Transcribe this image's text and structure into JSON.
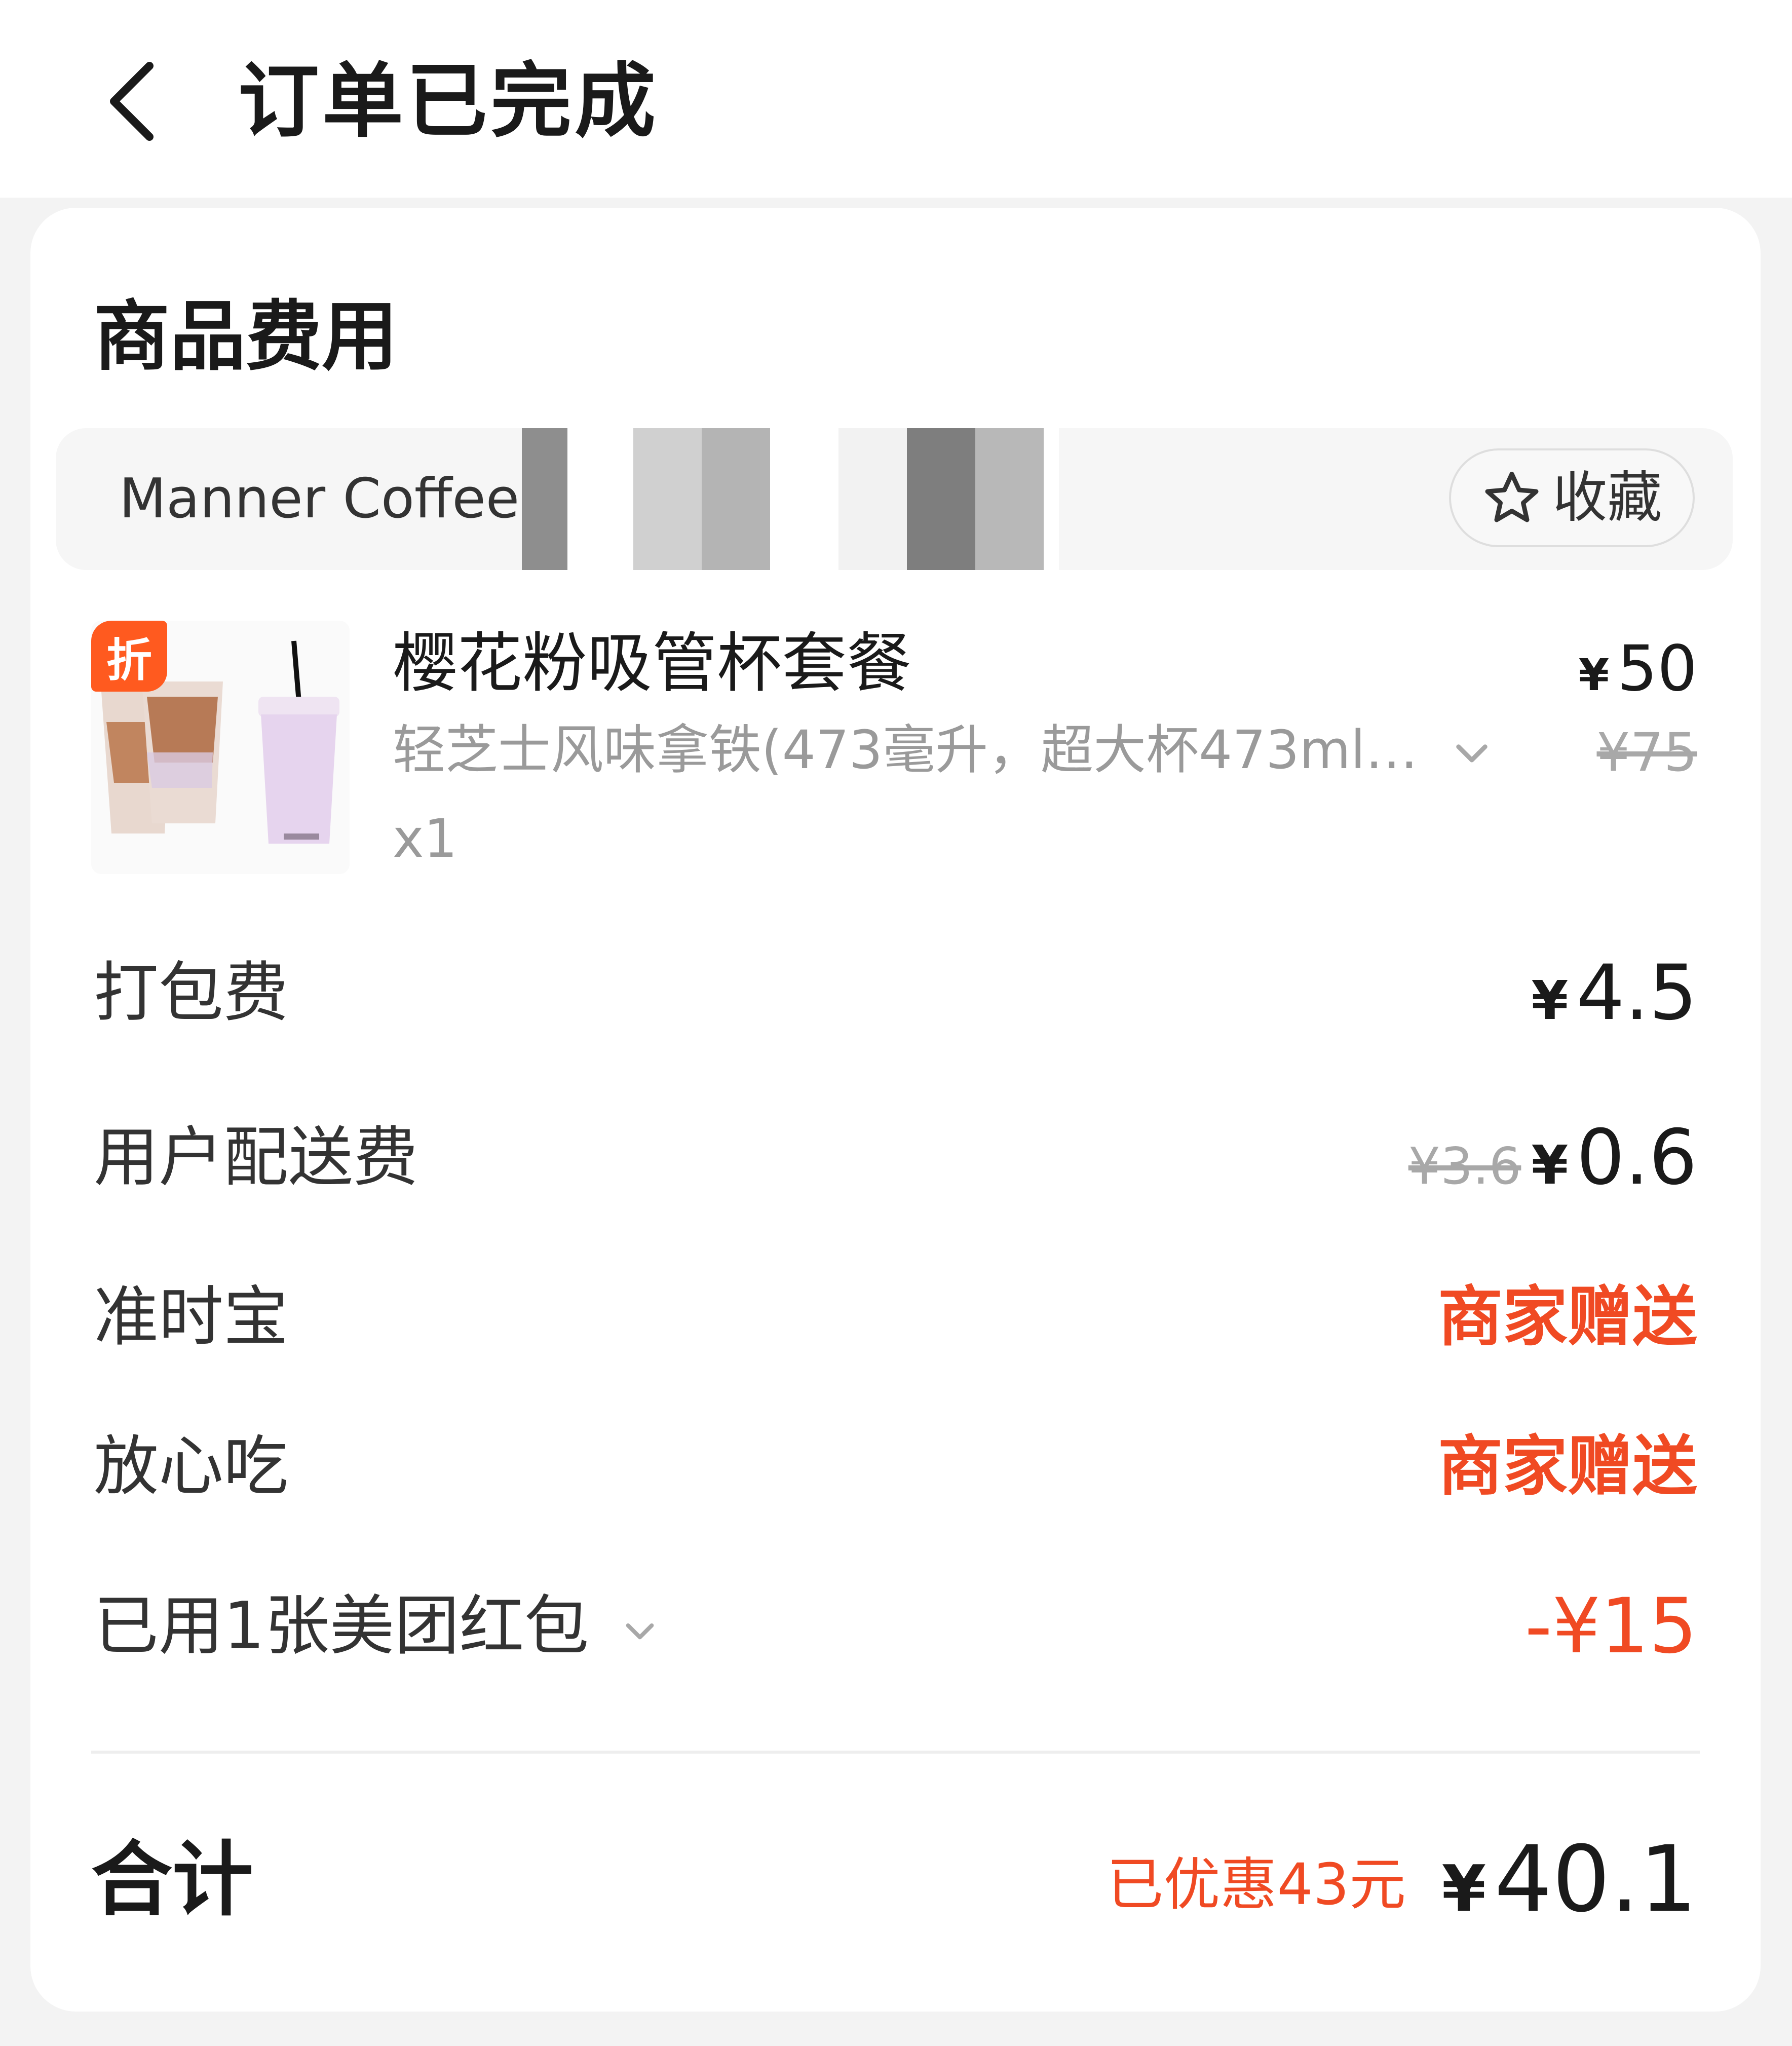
{
  "header": {
    "title": "订单已完成"
  },
  "section": {
    "title": "商品费用"
  },
  "shop": {
    "name": "Manner Coffee",
    "favorite_label": "收藏"
  },
  "product": {
    "badge": "折",
    "name": "樱花粉吸管杯套餐",
    "description": "轻芝士风味拿铁(473毫升，超大杯473ml…",
    "quantity": "x1",
    "price_currency": "¥",
    "price": "50",
    "original_price": "¥75"
  },
  "fees": {
    "packing": {
      "label": "打包费",
      "currency": "¥",
      "value": "4.5"
    },
    "delivery": {
      "label": "用户配送费",
      "original": "¥3.6",
      "currency": "¥",
      "value": "0.6"
    },
    "on_time": {
      "label": "准时宝",
      "value": "商家赠送"
    },
    "safe_eat": {
      "label": "放心吃",
      "value": "商家赠送"
    },
    "coupon": {
      "label": "已用1张美团红包",
      "value": "-¥15"
    }
  },
  "total": {
    "label": "合计",
    "saved": "已优惠43元",
    "currency": "¥",
    "amount": "40.1"
  },
  "colors": {
    "accent_red": "#f04a23",
    "badge_orange": "#ff5a1f"
  }
}
